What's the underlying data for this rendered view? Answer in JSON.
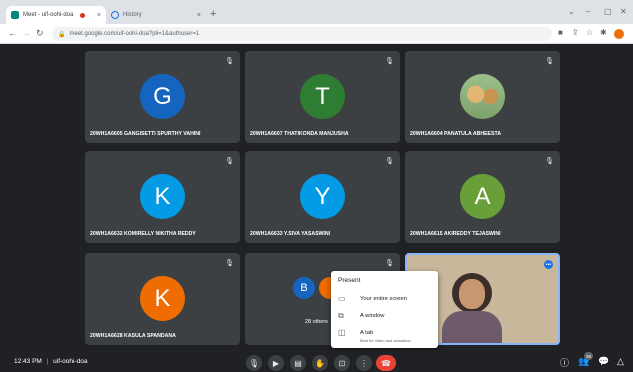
{
  "browser": {
    "tabs": [
      {
        "title": "Meet - uif-oohi-doa",
        "close": "×"
      },
      {
        "title": "History",
        "close": "×"
      }
    ],
    "new_tab": "+",
    "window_controls": [
      "⌄",
      "–",
      "▢",
      "✕"
    ],
    "url": "meet.google.com/uif-oohi-doa?pli=1&authuser=1"
  },
  "tiles": [
    {
      "initial": "G",
      "name": "20WH1A6605 GANGISETTI SPURTHY VAHINI",
      "color": "#1565c0"
    },
    {
      "initial": "T",
      "name": "20WH1A6607 THATIKONDA MANJUSHA",
      "color": "#2e7d32"
    },
    {
      "initial": "",
      "name": "20WH1A6604 PANATULA ABHEESTA",
      "color": "#8d6e63"
    },
    {
      "initial": "K",
      "name": "20WH1A6632 KOMIRELLY NIKITHA REDDY",
      "color": "#039be5"
    },
    {
      "initial": "Y",
      "name": "20WH1A6633 Y.SIVA YASASWINI",
      "color": "#039be5"
    },
    {
      "initial": "A",
      "name": "20WH1A6615 AKIREDDY TEJASWINI",
      "color": "#689f38"
    },
    {
      "initial": "K",
      "name": "20WH1A6628 KASULA SPANDANA",
      "color": "#ef6c00"
    }
  ],
  "others_tile": {
    "initials": [
      "B",
      ""
    ],
    "label": "28 others"
  },
  "present_menu": {
    "title": "Present",
    "items": [
      {
        "label": "Your entire screen",
        "sub": ""
      },
      {
        "label": "A window",
        "sub": ""
      },
      {
        "label": "A tab",
        "sub": "Best for video and animation"
      }
    ]
  },
  "meeting": {
    "time": "12:43 PM",
    "separator": "|",
    "code": "uif-oohi-doa",
    "participants": "36"
  }
}
